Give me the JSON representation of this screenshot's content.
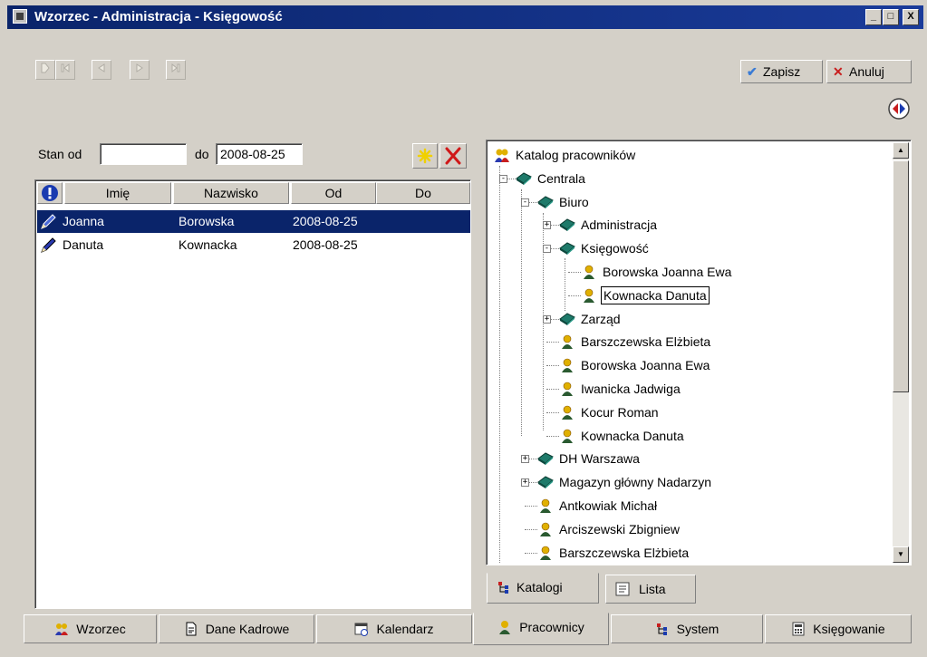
{
  "window": {
    "title": "Wzorzec - Administracja - Księgowość",
    "controls": [
      "_",
      "□",
      "X"
    ]
  },
  "toolbar": {
    "save_label": "Zapisz",
    "cancel_label": "Anuluj"
  },
  "filter": {
    "from_label": "Stan od",
    "from_value": "",
    "to_label": "do",
    "to_value": "2008-08-25"
  },
  "grid": {
    "columns": [
      "Imię",
      "Nazwisko",
      "Od",
      "Do"
    ],
    "rows": [
      {
        "first": "Joanna",
        "last": "Borowska",
        "from": "2008-08-25",
        "to": "",
        "selected": true
      },
      {
        "first": "Danuta",
        "last": "Kownacka",
        "from": "2008-08-25",
        "to": "",
        "selected": false
      }
    ]
  },
  "tree": {
    "nodes": [
      {
        "label": "Katalog pracowników",
        "icon": "group-icon",
        "depth": 0,
        "expander": ""
      },
      {
        "label": "Centrala",
        "icon": "book-icon",
        "depth": 1,
        "expander": "-"
      },
      {
        "label": "Biuro",
        "icon": "book-icon",
        "depth": 2,
        "expander": "-"
      },
      {
        "label": "Administracja",
        "icon": "book-icon",
        "depth": 3,
        "expander": "+"
      },
      {
        "label": "Księgowość",
        "icon": "book-icon",
        "depth": 3,
        "expander": "-"
      },
      {
        "label": "Borowska Joanna Ewa",
        "icon": "person-icon",
        "depth": 4,
        "expander": ""
      },
      {
        "label": "Kownacka Danuta",
        "icon": "person-icon",
        "depth": 4,
        "expander": "",
        "focused": true
      },
      {
        "label": "Zarząd",
        "icon": "book-icon",
        "depth": 3,
        "expander": "+"
      },
      {
        "label": "Barszczewska Elżbieta",
        "icon": "person-icon",
        "depth": 3,
        "expander": ""
      },
      {
        "label": "Borowska Joanna Ewa",
        "icon": "person-icon",
        "depth": 3,
        "expander": ""
      },
      {
        "label": "Iwanicka Jadwiga",
        "icon": "person-icon",
        "depth": 3,
        "expander": ""
      },
      {
        "label": "Kocur Roman",
        "icon": "person-icon",
        "depth": 3,
        "expander": ""
      },
      {
        "label": "Kownacka Danuta",
        "icon": "person-icon",
        "depth": 3,
        "expander": ""
      },
      {
        "label": "DH Warszawa",
        "icon": "book-icon",
        "depth": 2,
        "expander": "+"
      },
      {
        "label": "Magazyn główny Nadarzyn",
        "icon": "book-icon",
        "depth": 2,
        "expander": "+"
      },
      {
        "label": "Antkowiak Michał",
        "icon": "person-icon",
        "depth": 2,
        "expander": ""
      },
      {
        "label": "Arciszewski Zbigniew",
        "icon": "person-icon",
        "depth": 2,
        "expander": ""
      },
      {
        "label": "Barszczewska Elżbieta",
        "icon": "person-icon",
        "depth": 2,
        "expander": ""
      }
    ]
  },
  "subtabs": [
    {
      "label": "Katalogi",
      "icon": "tree-icon",
      "active": true
    },
    {
      "label": "Lista",
      "icon": "list-icon",
      "active": false
    }
  ],
  "tabs": [
    {
      "label": "Wzorzec",
      "icon": "group-icon",
      "active": false
    },
    {
      "label": "Dane Kadrowe",
      "icon": "document-icon",
      "active": false
    },
    {
      "label": "Kalendarz",
      "icon": "calendar-icon",
      "active": false
    },
    {
      "label": "Pracownicy",
      "icon": "person-icon",
      "active": true
    },
    {
      "label": "System",
      "icon": "tree-icon",
      "active": false
    },
    {
      "label": "Księgowanie",
      "icon": "calculator-icon",
      "active": false
    }
  ],
  "colors": {
    "titlebar": "#0a246a",
    "selection": "#0a246a",
    "face": "#d4d0c8"
  }
}
